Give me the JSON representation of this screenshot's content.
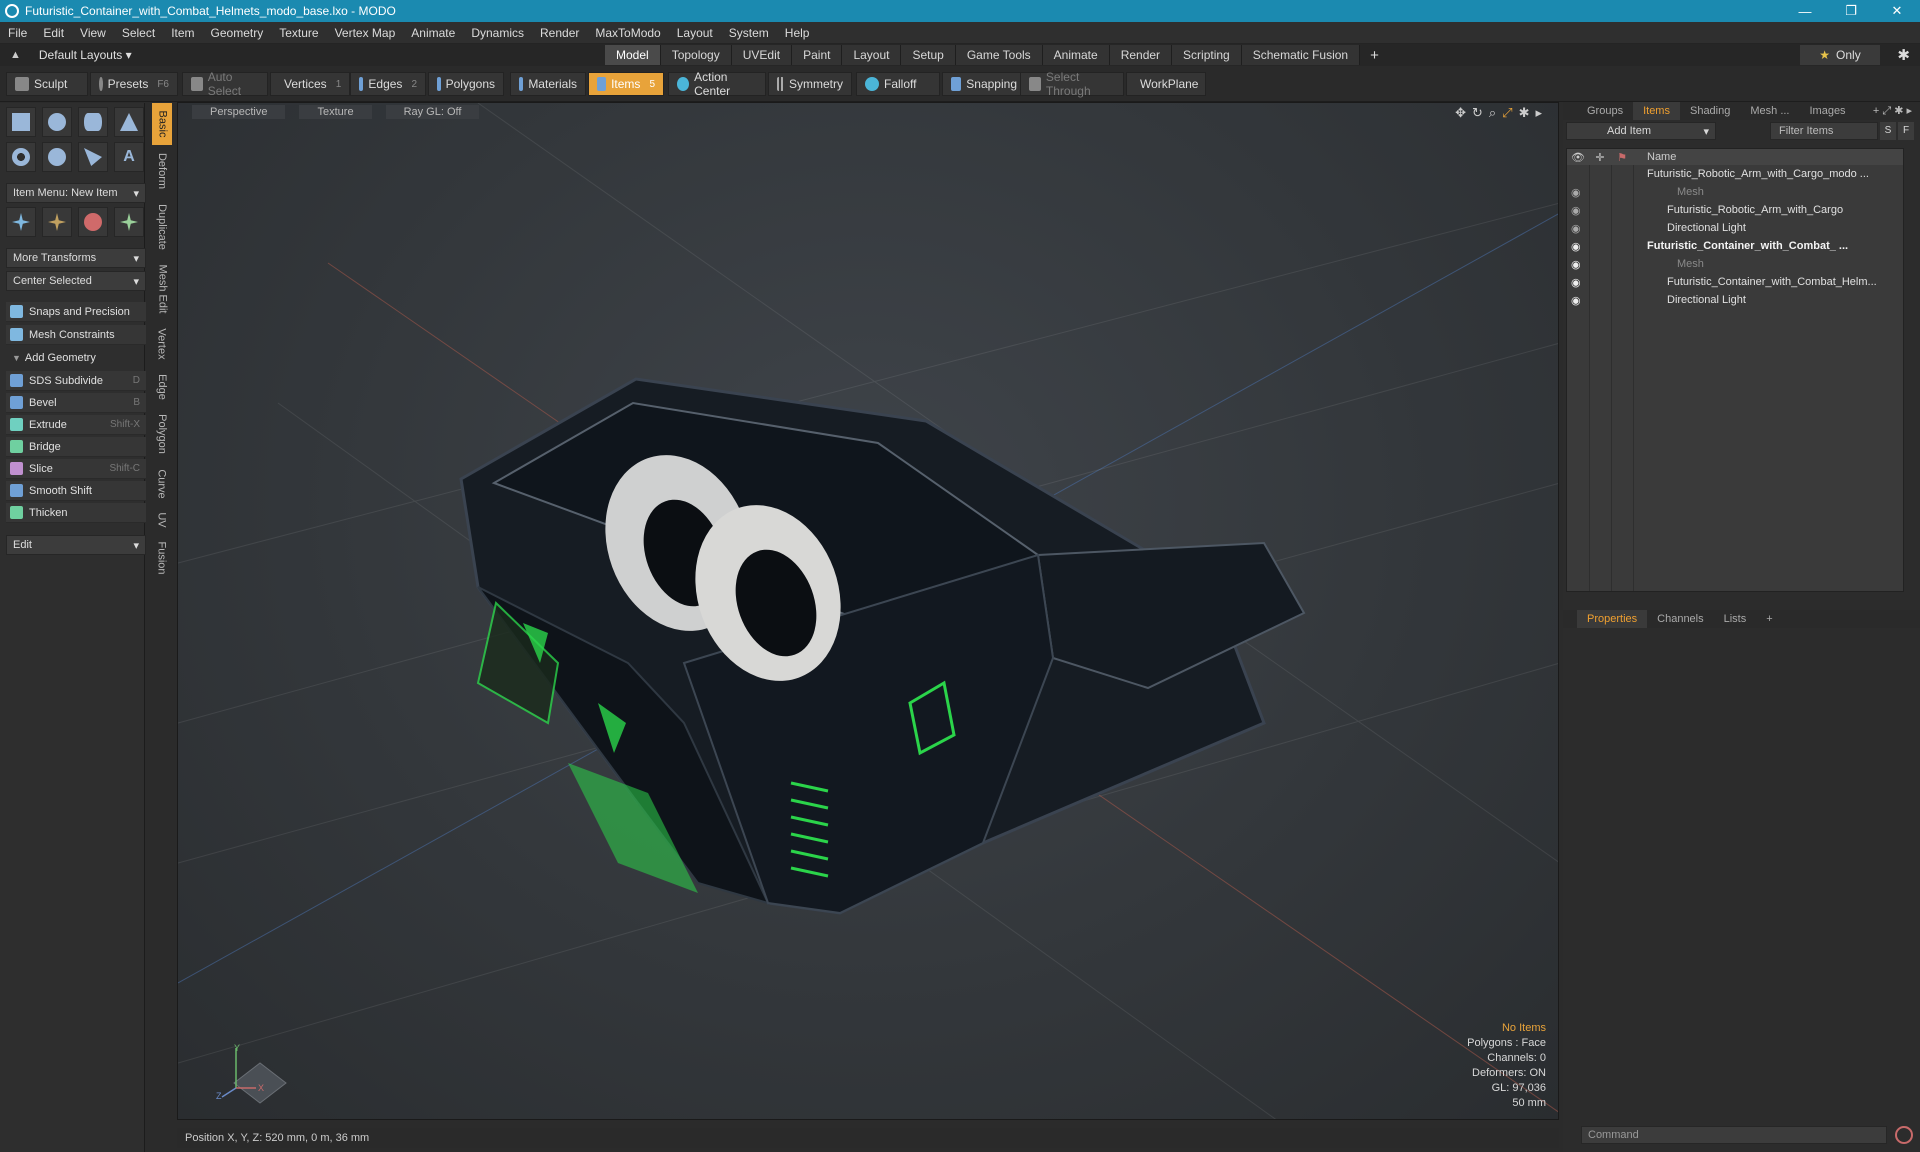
{
  "window": {
    "title": "Futuristic_Container_with_Combat_Helmets_modo_base.lxo - MODO",
    "minimize": "—",
    "maximize": "❐",
    "close": "✕"
  },
  "menu": [
    "File",
    "Edit",
    "View",
    "Select",
    "Item",
    "Geometry",
    "Texture",
    "Vertex Map",
    "Animate",
    "Dynamics",
    "Render",
    "MaxToModo",
    "Layout",
    "System",
    "Help"
  ],
  "layoutbar": {
    "layout_label": "Default Layouts ▾",
    "tabs": [
      "Model",
      "Topology",
      "UVEdit",
      "Paint",
      "Layout",
      "Setup",
      "Game Tools",
      "Animate",
      "Render",
      "Scripting",
      "Schematic Fusion"
    ],
    "active_tab": "Model",
    "plus": "+",
    "only": "Only",
    "star": "★",
    "gear": "✱"
  },
  "toolbar": {
    "sculpt": "Sculpt",
    "presets": "Presets",
    "presets_key": "F6",
    "auto_select": "Auto Select",
    "vertices": "Vertices",
    "vertices_count": "1",
    "edges": "Edges",
    "edges_count": "2",
    "polygons": "Polygons",
    "materials": "Materials",
    "items": "Items",
    "items_count": "5",
    "action_center": "Action Center",
    "symmetry": "Symmetry",
    "falloff": "Falloff",
    "snapping": "Snapping",
    "select_through": "Select Through",
    "workplane": "WorkPlane"
  },
  "left_panel": {
    "item_menu": "Item Menu: New Item",
    "more_transforms": "More Transforms",
    "center_selected": "Center Selected",
    "snaps": "Snaps and Precision",
    "constraints": "Mesh Constraints",
    "add_geometry": "Add Geometry",
    "tools": [
      {
        "label": "SDS Subdivide",
        "key": "D"
      },
      {
        "label": "Bevel",
        "key": "B"
      },
      {
        "label": "Extrude",
        "key": "Shift-X"
      },
      {
        "label": "Bridge",
        "key": ""
      },
      {
        "label": "Slice",
        "key": "Shift-C"
      },
      {
        "label": "Smooth Shift",
        "key": ""
      },
      {
        "label": "Thicken",
        "key": ""
      }
    ],
    "edit": "Edit",
    "vtabs": [
      "Basic",
      "Deform",
      "Duplicate",
      "Mesh Edit",
      "Vertex",
      "Edge",
      "Polygon",
      "Curve",
      "UV",
      "Fusion"
    ]
  },
  "viewport": {
    "view": "Perspective",
    "shading": "Texture",
    "raygl": "Ray GL: Off",
    "info": {
      "no_items": "No Items",
      "polygons": "Polygons : Face",
      "channels": "Channels: 0",
      "deformers": "Deformers: ON",
      "gl": "GL: 97,036",
      "scale": "50 mm"
    },
    "axes": {
      "y": "Y",
      "x": "X",
      "z": "Z"
    }
  },
  "status": {
    "position": "Position X, Y, Z:   520 mm, 0 m, 36 mm"
  },
  "right_panel": {
    "top_tabs": [
      "Groups",
      "Items",
      "Shading",
      "Mesh ...",
      "Images"
    ],
    "active_top": "Items",
    "add_item": "Add Item",
    "filter": "Filter Items",
    "s_btn": "S",
    "f_btn": "F",
    "name_col": "Name",
    "rows": [
      {
        "name": "Futuristic_Robotic_Arm_with_Cargo_modo ...",
        "style": "normal"
      },
      {
        "name": "Mesh",
        "style": "dim"
      },
      {
        "name": "Futuristic_Robotic_Arm_with_Cargo",
        "style": "normal"
      },
      {
        "name": "Directional Light",
        "style": "normal"
      },
      {
        "name": "Futuristic_Container_with_Combat_ ...",
        "style": "bold"
      },
      {
        "name": "Mesh",
        "style": "dim"
      },
      {
        "name": "Futuristic_Container_with_Combat_Helm...",
        "style": "normal"
      },
      {
        "name": "Directional Light",
        "style": "normal"
      }
    ],
    "bottom_tabs": [
      "Properties",
      "Channels",
      "Lists"
    ],
    "active_bottom": "Properties",
    "command_placeholder": "Command"
  },
  "colors": {
    "accent": "#e8a33a",
    "titlebar": "#1b8ab0",
    "glow_green": "#2bd44a"
  }
}
